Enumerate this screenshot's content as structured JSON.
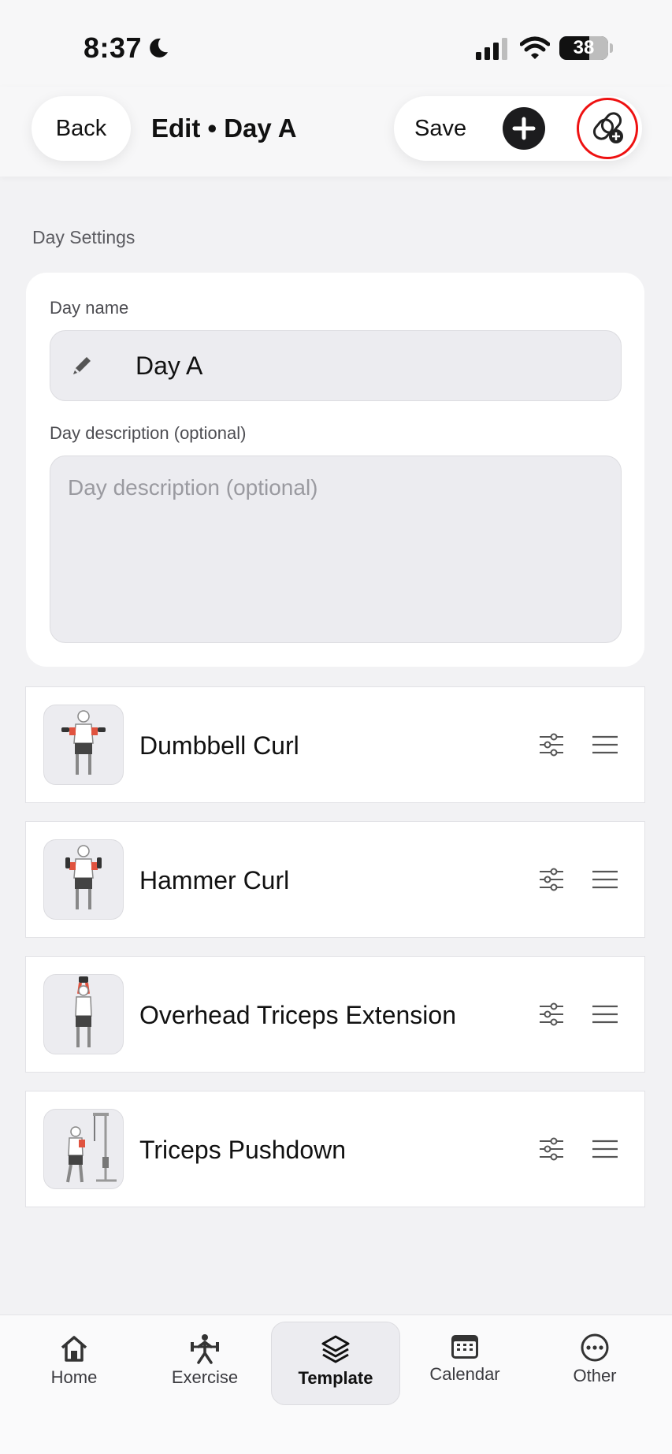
{
  "status_bar": {
    "time": "8:37",
    "battery": "38"
  },
  "header": {
    "back_label": "Back",
    "title": "Edit • Day A",
    "save_label": "Save"
  },
  "day_settings": {
    "section_label": "Day Settings",
    "name_label": "Day name",
    "name_value": "Day A",
    "description_label": "Day description (optional)",
    "description_placeholder": "Day description (optional)",
    "description_value": ""
  },
  "exercises": [
    {
      "name": "Dumbbell Curl"
    },
    {
      "name": "Hammer Curl"
    },
    {
      "name": "Overhead Triceps Extension"
    },
    {
      "name": "Triceps Pushdown"
    }
  ],
  "tabbar": {
    "items": [
      {
        "label": "Home",
        "icon": "house-icon"
      },
      {
        "label": "Exercise",
        "icon": "weightlifter-icon"
      },
      {
        "label": "Template",
        "icon": "layers-icon"
      },
      {
        "label": "Calendar",
        "icon": "calendar-icon"
      },
      {
        "label": "Other",
        "icon": "more-icon"
      }
    ],
    "active": "Template"
  },
  "colors": {
    "highlight_ring": "#ee1111",
    "muscle_highlight": "#e0533f",
    "background": "#f2f2f4"
  }
}
